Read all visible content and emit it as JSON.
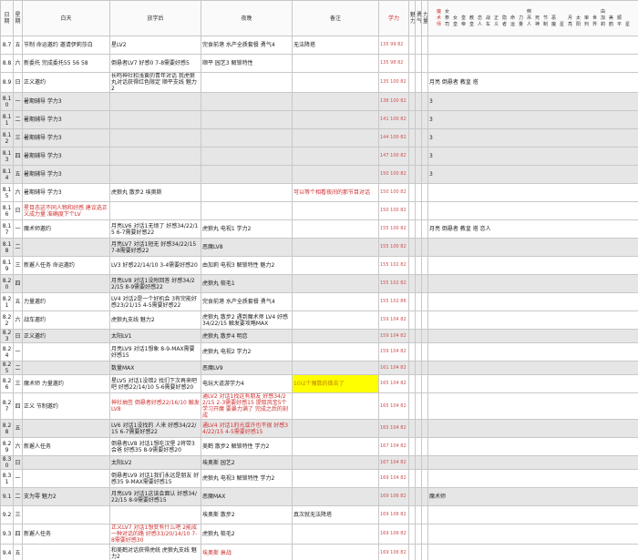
{
  "headers": [
    "日期",
    "星期",
    "白天",
    "放学后",
    "夜晚",
    "备注",
    "学力",
    "魅力",
    "勇气",
    "力量",
    "魔术师",
    "女祭司",
    "女皇",
    "皇帝",
    "教皇",
    "恋人",
    "战车",
    "正义",
    "隐者",
    "命运",
    "力量",
    "倒吊人",
    "死神",
    "节制",
    "恶魔",
    "星",
    "月亮",
    "太阳",
    "审判",
    "世界",
    "由加莉",
    "美鹤",
    "顺平",
    "星"
  ],
  "rows": [
    {
      "date": "8.7",
      "wd": "五",
      "day": "节制 命运邀约 邀请伊莉莎白",
      "after": "星LV2",
      "night": "完食前港 水产全质套餐 勇气4",
      "note": "无法降塔",
      "nums": "135 99 82",
      "x": "",
      "gray": false
    },
    {
      "date": "8.8",
      "wd": "六",
      "day": "新委托 完成委托55 56 58",
      "after": "倒悬者LV7 好感0 7-8需要好感5",
      "night": "顺平 园艺3 解锁特性",
      "note": "",
      "nums": "135 98 82",
      "x": "",
      "gray": false
    },
    {
      "date": "8.9",
      "wd": "日",
      "day": "正义邀约",
      "after": "长鸣神社和浅黄的青年对话 我虎狼丸对话获得红色限定 顺平支线 魅力2",
      "night": "",
      "note": "",
      "nums": "135 100 82",
      "x": "月亮 倒悬者 教皇 塔",
      "gray": false
    },
    {
      "date": "8.10",
      "wd": "一",
      "day": "暑期辅导 学力3",
      "after": "",
      "night": "",
      "note": "",
      "nums": "138 100 82",
      "x": "3",
      "gray": true
    },
    {
      "date": "8.11",
      "wd": "二",
      "day": "暑期辅导 学力3",
      "after": "",
      "night": "",
      "note": "",
      "nums": "141 100 82",
      "x": "3",
      "gray": true
    },
    {
      "date": "8.12",
      "wd": "三",
      "day": "暑期辅导 学力3",
      "after": "",
      "night": "",
      "note": "",
      "nums": "144 100 82",
      "x": "3",
      "gray": true
    },
    {
      "date": "8.13",
      "wd": "四",
      "day": "暑期辅导 学力3",
      "after": "",
      "night": "",
      "note": "",
      "nums": "147 100 82",
      "x": "3",
      "gray": true
    },
    {
      "date": "8.14",
      "wd": "五",
      "day": "暑期辅导 学力3",
      "after": "",
      "night": "",
      "note": "",
      "nums": "150 100 82",
      "x": "3",
      "gray": true
    },
    {
      "date": "8.15",
      "wd": "六",
      "day": "暑期辅导 学力3",
      "after": "虎狼丸 散步2 埃奥斯",
      "night": "",
      "note": "可以等个相看夜间的那节目对话",
      "nums": "150 100 82",
      "x": "",
      "gray": false
    },
    {
      "date": "8.16",
      "wd": "日",
      "day": "星目态这不同人物和好感 建议选正义成力量 准确度下个LV",
      "after": "",
      "night": "",
      "note": "",
      "nums": "150 100 82",
      "x": "",
      "gray": false
    },
    {
      "date": "8.17",
      "wd": "一",
      "day": "魔术师邀约",
      "after": "月亮LV6 对话1无烦了 好感34/22/15 6-7需要好感22",
      "night": "虎狼丸 电视1 学力2",
      "note": "",
      "nums": "155 100 82",
      "x": "月亮 倒悬者 教皇 塔 恋人",
      "gray": false
    },
    {
      "date": "8.18",
      "wd": "二",
      "day": "",
      "after": "月亮LV7 对话1短无 好感34/22/15 7-8需要好感22",
      "night": "恶魔LV8",
      "note": "",
      "nums": "155 100 82",
      "x": "",
      "gray": true
    },
    {
      "date": "8.19",
      "wd": "三",
      "day": "新邂人任务 命运邀约",
      "after": "LV3 好感22/14/10 3-4需要好感20",
      "night": "由加莉 电视3 解锁特性 魅力2",
      "note": "",
      "nums": "155 102 82",
      "x": "",
      "gray": false
    },
    {
      "date": "8.20",
      "wd": "四",
      "day": "",
      "after": "月亮LV8 对话1没附回答 好感34/22/15 8-9需要好感22",
      "night": "虎狼丸 梳毛1",
      "note": "",
      "nums": "155 102 82",
      "x": "",
      "gray": true
    },
    {
      "date": "8.21",
      "wd": "五",
      "day": "力量邀约",
      "after": "LV4 对话2是一个好机会 3有完能好感23/21/15 4-5需要好感22",
      "night": "完食前港 水产全质套餐 勇气4",
      "note": "",
      "nums": "155 102 86",
      "x": "",
      "gray": false
    },
    {
      "date": "8.22",
      "wd": "六",
      "day": "战车邀约",
      "after": "虎狼丸支线 魅力2",
      "night": "虎狼丸 散步2 遇到魔术师 LV4 好感34/22/15 触发要攻略MAX",
      "note": "",
      "nums": "159 104 82",
      "x": "",
      "gray": false
    },
    {
      "date": "8.23",
      "wd": "日",
      "day": "正义邀约",
      "after": "太阳LV1",
      "night": "虎狼丸 散步4 明恋",
      "note": "",
      "nums": "159 104 82",
      "x": "",
      "gray": true
    },
    {
      "date": "8.24",
      "wd": "一",
      "day": "",
      "after": "月亮LV9 对话1想象 8-9-MAX需要好感15",
      "night": "虎狼丸 电视2 学力2",
      "note": "",
      "nums": "159 104 82",
      "x": "",
      "gray": false
    },
    {
      "date": "8.25",
      "wd": "二",
      "day": "",
      "after": "数量MAX",
      "night": "恶魔LV9",
      "note": "",
      "nums": "161 104 82",
      "x": "",
      "gray": true
    },
    {
      "date": "8.26",
      "wd": "三",
      "day": "魔术师 力量邀约",
      "after": "星LV5 对话1没错2 找们下次再来吧吧 好感22/14/10 5-6需要好感20",
      "night": "电玩大道游学力4",
      "note": "10以个魔数的做去了",
      "nums": "165 104 82",
      "x": "",
      "gray": false
    },
    {
      "date": "8.27",
      "wd": "四",
      "day": "正义 节制邀约",
      "after": "神社抽签 倒悬者好感22/16/10 触发LV8",
      "night": "通LV2 对话1找这有朋友 好感34/22/15 2-3需要好感15 提取风宝5个 学习开魔 要暴力满了 完成之后的刻成",
      "note": "",
      "nums": "165 104 82",
      "x": "",
      "gray": false
    },
    {
      "date": "8.28",
      "wd": "五",
      "day": "",
      "after": "LV6 对话1没找的 人来 好感34/22/15 6-7需要好感22",
      "night": "通LV4 对话1的光或许也不很 好感34/22/15 4-5需要好感15",
      "note": "",
      "nums": "165 104 82",
      "x": "",
      "gray": true
    },
    {
      "date": "8.29",
      "wd": "六",
      "day": "新邂人任务",
      "after": "倒悬者LV8 对话1想吃汉堡 2将带3会爸 好感35 8-9需要好感20",
      "night": "美鹤 散步2 解锁特性 学力2",
      "note": "",
      "nums": "167 104 82",
      "x": "",
      "gray": false
    },
    {
      "date": "8.30",
      "wd": "日",
      "day": "",
      "after": "太阳LV2",
      "night": "埃奥斯 园艺2",
      "note": "",
      "nums": "167 104 82",
      "x": "",
      "gray": true
    },
    {
      "date": "8.31",
      "wd": "一",
      "day": "",
      "after": "倒悬者LV9 对话1我们永远是朋友 好感35 9-MAX需要好感15",
      "night": "虎狼丸 电视3 解锁特性 学力2",
      "note": "",
      "nums": "169 104 82",
      "x": "",
      "gray": false
    },
    {
      "date": "9.1",
      "wd": "二",
      "day": "支为零 魅力2",
      "after": "月亮LV9 对话1这该会面认 好感34/22/15 8-9需要好感15",
      "night": "恶魔MAX",
      "note": "",
      "nums": "169 106 82",
      "x": "魔术师",
      "gray": true
    },
    {
      "date": "9.2",
      "wd": "三",
      "day": "",
      "after": "",
      "night": "埃奥斯 散步2",
      "note": "真次就无法降塔",
      "nums": "169 106 82",
      "x": "",
      "gray": false
    },
    {
      "date": "9.3",
      "wd": "四",
      "day": "新邂人任务",
      "after": "正义LV7 对话1想变有什么吧 2能成一种对话的路 好感33/20/14/10 7-8需要好感30",
      "night": "虎狼丸 梳毛2",
      "note": "",
      "nums": "169 106 82",
      "x": "",
      "gray": false
    },
    {
      "date": "9.4",
      "wd": "五",
      "day": "",
      "after": "和美鹤对话获得虎统 虎狼丸支线 魅力2",
      "night": "埃奥斯 衰战",
      "note": "",
      "nums": "169 106 82",
      "x": "",
      "gray": false
    },
    {
      "date": "9.5",
      "wd": "六",
      "day": "",
      "after": "",
      "night": "满月BOSS战",
      "note": "",
      "nums": "169 106 82",
      "x": "",
      "gray": false
    }
  ]
}
